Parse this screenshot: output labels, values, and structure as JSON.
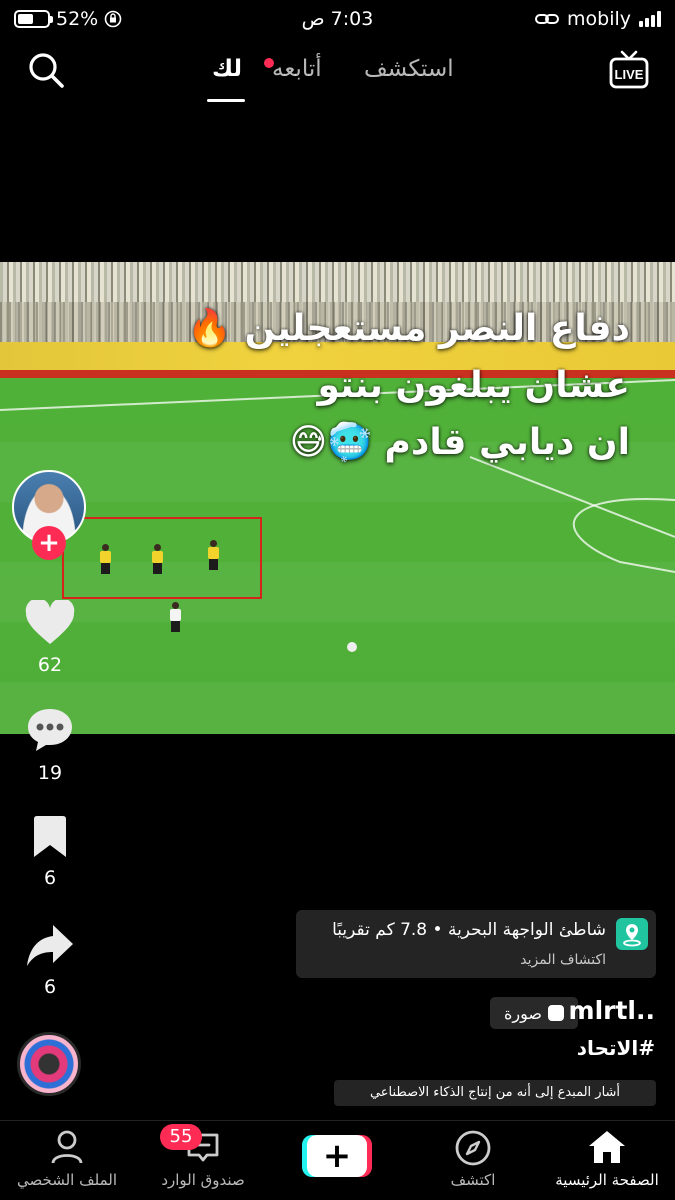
{
  "status_bar": {
    "battery": "52%",
    "battery_level": 0.52,
    "time": "7:03 ص",
    "carrier": "mobily"
  },
  "header": {
    "tabs": [
      {
        "label": "استكشف",
        "active": false
      },
      {
        "label": "أتابعه",
        "active": false,
        "has_dot": true
      },
      {
        "label": "لك",
        "active": true
      }
    ],
    "live_label": "LIVE",
    "search_icon": "search-icon"
  },
  "video": {
    "overlay_lines": [
      "دفاع النصر مستعجلين 🔥",
      "عشان يبلغون بنتو",
      "ان ديابي قادم 🥶😅"
    ]
  },
  "actions": {
    "likes": "62",
    "comments": "19",
    "bookmarks": "6",
    "shares": "6",
    "follow_label": "+"
  },
  "post": {
    "location_name": "شاطئ الواجهة البحرية • 7.8 كم تقريبًا",
    "location_more": "اكتشاف المزيد",
    "username": "mlrtl..",
    "photo_badge": "صورة",
    "hashtag": "#الاتحاد",
    "ai_label": "أشار المبدع إلى أنه من إنتاج الذكاء الاصطناعي"
  },
  "tabbar": {
    "items": [
      {
        "label": "الملف الشخصي",
        "icon": "profile-icon"
      },
      {
        "label": "صندوق الوارد",
        "icon": "inbox-icon"
      },
      {
        "label": "+",
        "icon": "create-icon"
      },
      {
        "label": "اكتشف",
        "icon": "compass-icon"
      },
      {
        "label": "الصفحة الرئيسية",
        "icon": "home-icon"
      }
    ],
    "inbox_badge": "55"
  },
  "colors": {
    "accent_red": "#fe2c55",
    "accent_cyan": "#25f4ee",
    "background": "#000000"
  }
}
